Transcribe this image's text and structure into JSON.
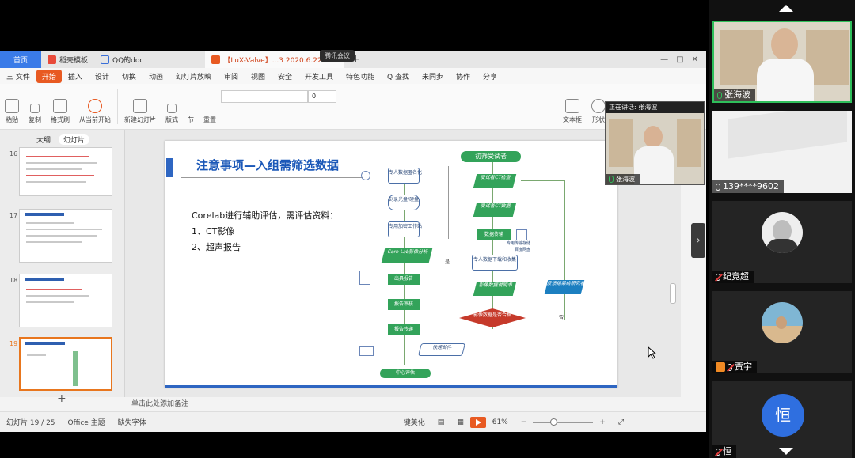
{
  "window_tabs": {
    "home": "首页",
    "tab1": "稻壳模板",
    "tab2": "QQ的doc",
    "tab3": "【LuX-Valve】...3 2020.6.22"
  },
  "meeting_pill": "腾讯会议",
  "menus": [
    "三 文件",
    "开始",
    "插入",
    "设计",
    "切换",
    "动画",
    "幻灯片放映",
    "审阅",
    "视图",
    "安全",
    "开发工具",
    "特色功能",
    "Q 查找",
    "未同步",
    "协作",
    "分享"
  ],
  "ribbon": {
    "paste": "粘贴",
    "copy": "复制",
    "format_painter": "格式刷",
    "from_current": "从当前开始",
    "new_slide": "新建幻灯片",
    "layout": "版式",
    "section": "节",
    "reset": "重置",
    "font_size": "0",
    "textbox": "文本框",
    "shape": "形状",
    "arrange": "排列"
  },
  "left_panel": {
    "tab_outline": "大纲",
    "tab_slides": "幻灯片",
    "slide_numbers": [
      "16",
      "17",
      "18",
      "19"
    ]
  },
  "slide": {
    "title": "注意事项—入组需筛选数据",
    "body_line1": "Corelab进行辅助评估，需评估资料：",
    "body_line2": "1、CT影像",
    "body_line3": "2、超声报告",
    "flow": {
      "start": "初筛受试者",
      "n1": "受试者CT检查",
      "n2": "受试者CT数据",
      "n3": "数据传输",
      "n4": "专人数据下载和收集",
      "n5": "影像数据说明书",
      "decision": "影像数据是否合格",
      "feedback": "反馈结果给研究者",
      "l1": "专人数据匿名化",
      "l2": "刻录光盘/硬盘",
      "l3": "专用加密工作站",
      "l4": "Core-Lab影像分析",
      "l5": "出具报告",
      "l6": "报告审核",
      "l7": "报告传递",
      "l8": "快速邮件",
      "end": "中心评估",
      "note1": "专用传输存储",
      "note2": "百度网盘",
      "yes": "是",
      "no": "否"
    }
  },
  "notes_placeholder": "单击此处添加备注",
  "statusbar": {
    "slide_count": "幻灯片 19 / 25",
    "theme": "Office 主题",
    "font_missing": "缺失字体",
    "beautify": "一键美化",
    "zoom": "61%"
  },
  "speaker_float": {
    "label": "正在讲话: 张海波",
    "name": "张海波"
  },
  "participants": [
    {
      "name": "张海波",
      "muted": false,
      "active": true
    },
    {
      "name": "139****9602",
      "muted": false,
      "active": false
    },
    {
      "name": "纪竞超",
      "muted": true,
      "active": false
    },
    {
      "name": "贾宇",
      "muted": true,
      "active": false
    },
    {
      "name": "恒",
      "muted": true,
      "active": false,
      "avatar_char": "恒"
    }
  ],
  "colors": {
    "accent_orange": "#e85a22",
    "slide_blue": "#1b58b8",
    "flow_green": "#33a35a",
    "active_green": "#2fbf5b"
  }
}
